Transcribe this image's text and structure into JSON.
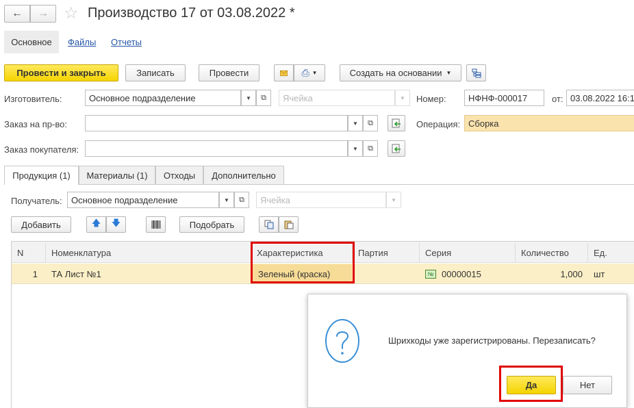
{
  "window": {
    "title": "Производство 17 от 03.08.2022 *"
  },
  "nav_tabs": [
    "Основное",
    "Файлы",
    "Отчеты"
  ],
  "toolbar": {
    "post_close": "Провести и закрыть",
    "save": "Записать",
    "post": "Провести",
    "create_based": "Создать на основании"
  },
  "form": {
    "manufacturer_label": "Изготовитель:",
    "manufacturer_value": "Основное подразделение",
    "cell_placeholder": "Ячейка",
    "number_label": "Номер:",
    "number_value": "НФНФ-000017",
    "date_label": "от:",
    "date_value": "03.08.2022 16:1",
    "order_label": "Заказ на пр-во:",
    "operation_label": "Операция:",
    "operation_value": "Сборка",
    "customer_order_label": "Заказ покупателя:"
  },
  "doc_tabs": [
    "Продукция (1)",
    "Материалы (1)",
    "Отходы",
    "Дополнительно"
  ],
  "recipient": {
    "label": "Получатель:",
    "value": "Основное подразделение",
    "cell_placeholder": "Ячейка"
  },
  "table_toolbar": {
    "add": "Добавить",
    "select": "Подобрать"
  },
  "table": {
    "headers": [
      "N",
      "Номенклатура",
      "Характеристика",
      "Партия",
      "Серия",
      "Количество",
      "Ед."
    ],
    "rows": [
      {
        "n": "1",
        "item": "ТА Лист №1",
        "characteristic": "Зеленый (краска)",
        "batch": "",
        "series": "00000015",
        "quantity": "1,000",
        "unit": "шт"
      }
    ]
  },
  "dialog": {
    "message": "Шрихкоды уже зарегистрированы. Перезаписать?",
    "yes": "Да",
    "no": "Нет"
  },
  "colors": {
    "accent_yellow": "#f5d400",
    "row_highlight": "#fbefc7",
    "annotation_red": "#e00000",
    "link_blue": "#2455a6"
  }
}
